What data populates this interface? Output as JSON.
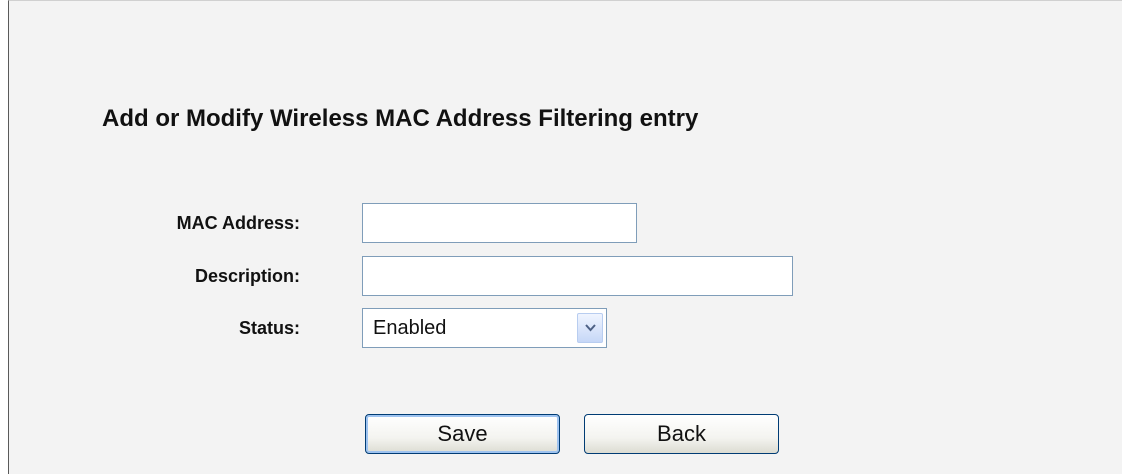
{
  "form": {
    "title": "Add or Modify Wireless MAC Address Filtering entry",
    "mac_address_label": "MAC Address:",
    "mac_address_value": "",
    "description_label": "Description:",
    "description_value": "",
    "status_label": "Status:",
    "status_selected": "Enabled"
  },
  "buttons": {
    "save_label": "Save",
    "back_label": "Back"
  },
  "icons": {
    "dropdown": "chevron-down-icon"
  },
  "colors": {
    "panel_background": "#f3f3f3",
    "input_border": "#7f9db9",
    "button_border": "#003c74"
  }
}
